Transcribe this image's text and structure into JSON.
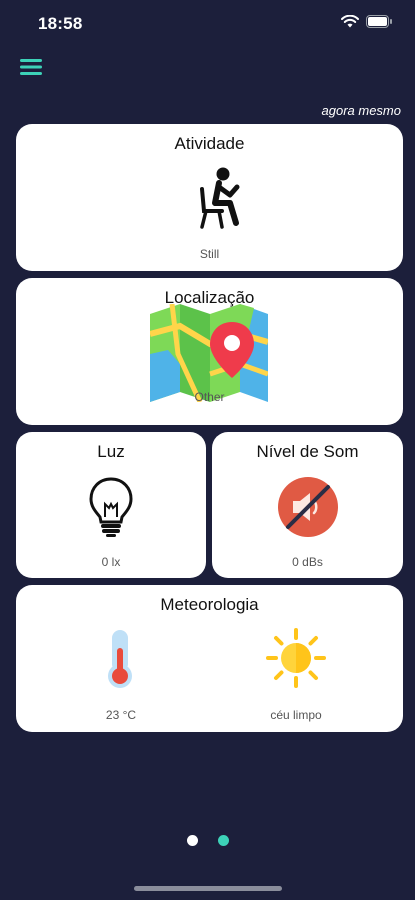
{
  "status_bar": {
    "time": "18:58"
  },
  "header": {
    "updated_label": "agora mesmo"
  },
  "cards": {
    "activity": {
      "title": "Atividade",
      "value": "Still",
      "icon": "person-sitting-icon"
    },
    "location": {
      "title": "Localização",
      "value": "Other",
      "icon": "map-pin-icon"
    },
    "light": {
      "title": "Luz",
      "value": "0 lx",
      "icon": "light-bulb-icon"
    },
    "sound": {
      "title": "Nível de Som",
      "value": "0 dBs",
      "icon": "speaker-muted-icon"
    },
    "weather": {
      "title": "Meteorologia",
      "temperature": "23 °C",
      "condition": "céu limpo",
      "temperature_icon": "thermometer-icon",
      "condition_icon": "sun-icon"
    }
  },
  "pager": {
    "pages": 2,
    "active_index": 1,
    "active_color": "#3dd2b8",
    "inactive_color": "#ffffff"
  },
  "colors": {
    "background": "#1c1f3b",
    "accent": "#3dd2b8"
  }
}
